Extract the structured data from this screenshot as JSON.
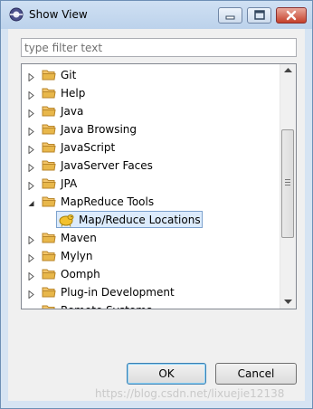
{
  "window": {
    "title": "Show View"
  },
  "filter": {
    "placeholder": "type filter text"
  },
  "tree": {
    "items": [
      {
        "label": "Git",
        "expanded": false
      },
      {
        "label": "Help",
        "expanded": false
      },
      {
        "label": "Java",
        "expanded": false
      },
      {
        "label": "Java Browsing",
        "expanded": false
      },
      {
        "label": "JavaScript",
        "expanded": false
      },
      {
        "label": "JavaServer Faces",
        "expanded": false
      },
      {
        "label": "JPA",
        "expanded": false
      },
      {
        "label": "MapReduce Tools",
        "expanded": true
      },
      {
        "label": "Map/Reduce Locations",
        "child": true,
        "selected": true
      },
      {
        "label": "Maven",
        "expanded": false
      },
      {
        "label": "Mylyn",
        "expanded": false
      },
      {
        "label": "Oomph",
        "expanded": false
      },
      {
        "label": "Plug-in Development",
        "expanded": false
      },
      {
        "label": "Remote Systems",
        "expanded": false
      }
    ]
  },
  "buttons": {
    "ok": "OK",
    "cancel": "Cancel"
  },
  "watermark": "https://blog.csdn.net/lixuejie12138",
  "colors": {
    "titlebar": "#c4d7ee",
    "selection": "#dcebfc",
    "folder": "#e8b74a",
    "close": "#c5402a"
  }
}
